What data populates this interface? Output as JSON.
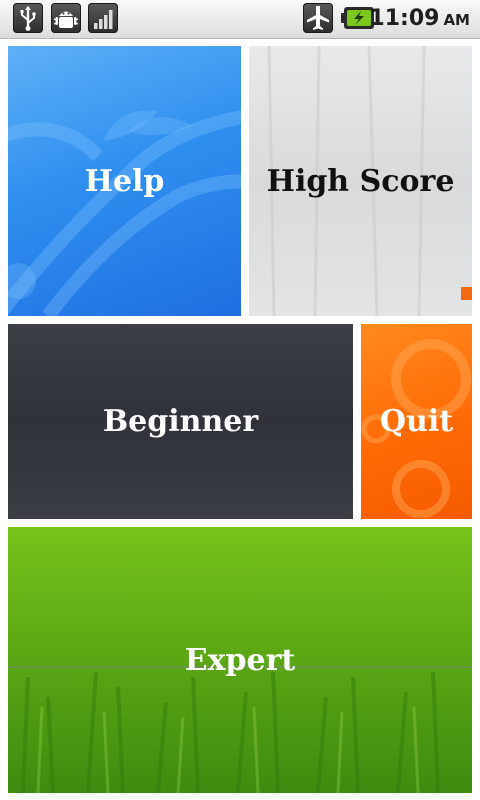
{
  "status_bar": {
    "time": "11:09",
    "ampm": "AM",
    "left_icons": [
      "usb-icon",
      "android-debug-icon",
      "signal-bars-icon"
    ],
    "right_icons": [
      "airplane-mode-icon",
      "battery-charging-icon"
    ]
  },
  "tiles": {
    "help": "Help",
    "high_score": "High Score",
    "beginner": "Beginner",
    "quit": "Quit",
    "expert": "Expert"
  },
  "colors": {
    "help": "#2f8fef",
    "high_score": "#dcdddf",
    "beginner": "#33373d",
    "quit": "#ff6a06",
    "expert": "#5aa614"
  }
}
